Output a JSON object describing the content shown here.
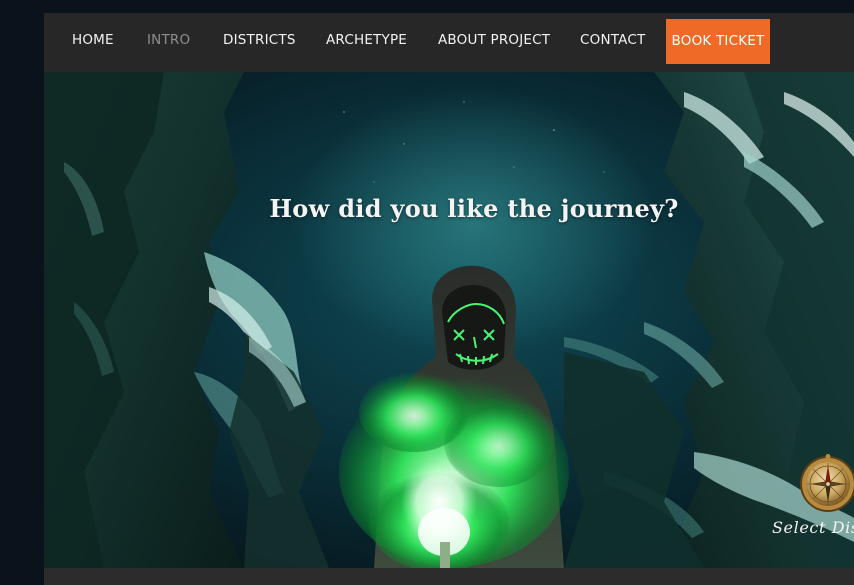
{
  "nav": {
    "items": [
      {
        "id": "home",
        "label": "HOME"
      },
      {
        "id": "intro",
        "label": "INTRO",
        "active": true
      },
      {
        "id": "districts",
        "label": "DISTRICTS"
      },
      {
        "id": "archetype",
        "label": "ARCHETYPE"
      },
      {
        "id": "about",
        "label": "ABOUT PROJECT"
      },
      {
        "id": "contact",
        "label": "CONTACT"
      }
    ],
    "cta_label": "BOOK TICKET"
  },
  "hero": {
    "title": "How did you like the journey?",
    "compass_label": "Select Districts",
    "compass_icon": "compass-icon"
  },
  "colors": {
    "page_bg": "#0a121b",
    "nav_bg": "#272727",
    "nav_text": "#f2f2f2",
    "nav_active": "#8d8d8d",
    "cta_bg": "#ee6a26",
    "smoke_green": "#3dff6a"
  }
}
